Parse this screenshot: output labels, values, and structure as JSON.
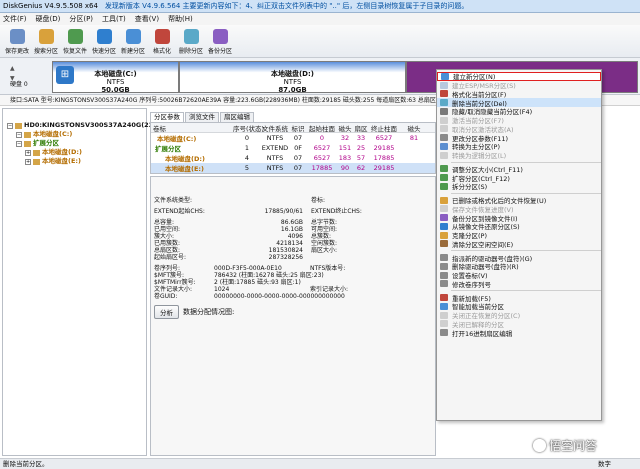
{
  "window": {
    "title": "DiskGenius V4.9.5.508 x64",
    "notice": "发现新版本 V4.9.6.564 主要更新内容如下：4、纠正双击文件列表中的 \"..\" 后，左侧目录树恢复属于子目录的问题。"
  },
  "menu": [
    "文件(F)",
    "硬盘(D)",
    "分区(P)",
    "工具(T)",
    "查看(V)",
    "帮助(H)"
  ],
  "toolbar": [
    {
      "label": "保存更改",
      "icon": "save-icon",
      "color": "#6b8fc6"
    },
    {
      "label": "搜索分区",
      "icon": "search-icon",
      "color": "#d9a13b"
    },
    {
      "label": "恢复文件",
      "icon": "recover-icon",
      "color": "#4f9a4f"
    },
    {
      "label": "快速分区",
      "icon": "quick-partition-icon",
      "color": "#2f7fcf"
    },
    {
      "label": "新建分区",
      "icon": "new-partition-icon",
      "color": "#4a8fd6"
    },
    {
      "label": "格式化",
      "icon": "format-icon",
      "color": "#c0463c"
    },
    {
      "label": "删除分区",
      "icon": "delete-partition-icon",
      "color": "#5aa9c8"
    },
    {
      "label": "备份分区",
      "icon": "backup-icon",
      "color": "#8a5ec2"
    }
  ],
  "disk_strip": {
    "disk_label": "硬盘 0",
    "partitions": [
      {
        "name": "本地磁盘(C:)",
        "fs": "NTFS",
        "size": "50.0GB"
      },
      {
        "name": "本地磁盘(D:)",
        "fs": "NTFS",
        "size": "87.0GB"
      },
      {
        "name": "",
        "fs": "",
        "size": ""
      }
    ]
  },
  "disk_info": "接口:SATA  型号:KINGSTONSV300S37A240G  序列号:50026B72620AE39A  容量:223.6GB(228936MB)  柱面数:29185  磁头数:255  每道扇区数:63  总扇区数:468862128",
  "tree": [
    {
      "text": "HD0:KINGSTONSV300S37A240G(224GB)",
      "level": 0,
      "style": "bold"
    },
    {
      "text": "本地磁盘(C:)",
      "level": 1,
      "style": "orange"
    },
    {
      "text": "扩展分区",
      "level": 1,
      "style": "green"
    },
    {
      "text": "本地磁盘(D:)",
      "level": 2,
      "style": "orange"
    },
    {
      "text": "本地磁盘(E:)",
      "level": 2,
      "style": "orange"
    }
  ],
  "tabs": [
    "分区参数",
    "浏览文件",
    "扇区编辑"
  ],
  "ptable": {
    "headers": [
      "卷标",
      "序号(状态)",
      "文件系统",
      "标识",
      "起始柱面",
      "磁头",
      "扇区",
      "终止柱面",
      "磁头"
    ],
    "rows": [
      {
        "label": "本地磁盘(C:)",
        "cells": [
          "0",
          "NTFS",
          "07",
          "0",
          "32",
          "33",
          "6527",
          "81"
        ],
        "cls": ""
      },
      {
        "label": "扩展分区",
        "cells": [
          "1",
          "EXTEND",
          "0F",
          "6527",
          "151",
          "25",
          "29185",
          ""
        ],
        "cls": ""
      },
      {
        "label": "本地磁盘(D:)",
        "cells": [
          "4",
          "NTFS",
          "07",
          "6527",
          "183",
          "57",
          "17885",
          ""
        ],
        "cls": ""
      },
      {
        "label": "本地磁盘(E:)",
        "cells": [
          "5",
          "NTFS",
          "07",
          "17885",
          "90",
          "62",
          "29185",
          ""
        ],
        "cls": "sel"
      }
    ]
  },
  "details": {
    "fs_type_label": "文件系统类型:",
    "fs_type_value": "",
    "vol_label_label": "卷标:",
    "vol_label_value": "",
    "extend_chs_label": "EXTEND起始CHS:",
    "extend_chs_value": "17885/90/61",
    "extend_end_label": "EXTEND终止CHS:",
    "rows1": [
      {
        "k": "总容量:",
        "v": "86.6GB",
        "k2": "总字节数:",
        "v2": ""
      },
      {
        "k": "已用空间:",
        "v": "16.1GB",
        "k2": "可用空间:",
        "v2": ""
      },
      {
        "k": "簇大小:",
        "v": "4096",
        "k2": "总簇数:",
        "v2": ""
      },
      {
        "k": "已用簇数:",
        "v": "4218134",
        "k2": "空闲簇数:",
        "v2": ""
      },
      {
        "k": "总扇区数:",
        "v": "181530824",
        "k2": "扇区大小:",
        "v2": ""
      },
      {
        "k": "起始扇区号:",
        "v": "287328256",
        "k2": "",
        "v2": ""
      }
    ],
    "rows2": [
      {
        "k": "卷序列号:",
        "v": "000D-F3F5-000A-0E10",
        "k2": "NTFS版本号:",
        "v2": ""
      },
      {
        "k": "$MFT簇号:",
        "v": "786432 (柱面:16278 磁头:25 扇区:23)",
        "k2": "",
        "v2": ""
      },
      {
        "k": "$MFTMirr簇号:",
        "v": "2 (柱面:17885 磁头:93 扇区:1)",
        "k2": "",
        "v2": ""
      },
      {
        "k": "文件记录大小:",
        "v": "1024",
        "k2": "索引记录大小:",
        "v2": ""
      },
      {
        "k": "卷GUID:",
        "v": "00000000-0000-0000-0000-000000000000",
        "k2": "",
        "v2": ""
      }
    ],
    "analyze_button": "分析",
    "analyze_label": "数据分配情况图:"
  },
  "context_menu": [
    {
      "label": "建立新分区(N)",
      "state": "highlight",
      "color": "#4a8fd6"
    },
    {
      "label": "建立ESP/MSR分区(S)",
      "state": "disabled",
      "color": "#b7c8de"
    },
    {
      "label": "格式化当前分区(F)",
      "state": "normal",
      "color": "#c0463c"
    },
    {
      "label": "删除当前分区(Del)",
      "state": "hover",
      "color": "#5aa9c8"
    },
    {
      "label": "隐藏/取消隐藏当前分区(F4)",
      "state": "normal",
      "color": "#7a7a7a"
    },
    {
      "label": "激活当前分区(F7)",
      "state": "disabled",
      "color": "#cfcfcf"
    },
    {
      "label": "取消分区激活状态(A)",
      "state": "disabled",
      "color": "#cfcfcf"
    },
    {
      "label": "更改分区参数(F11)",
      "state": "normal",
      "color": "#8a8a8a"
    },
    {
      "label": "转换为主分区(P)",
      "state": "normal",
      "color": "#5d8fd0"
    },
    {
      "label": "转换为逻辑分区(L)",
      "state": "disabled",
      "color": "#cfcfcf"
    },
    {
      "sep": true
    },
    {
      "label": "调整分区大小(Ctrl_F11)",
      "state": "normal",
      "color": "#4f9a4f"
    },
    {
      "label": "扩容分区(Ctrl_F12)",
      "state": "normal",
      "color": "#4f9a4f"
    },
    {
      "label": "拆分分区(S)",
      "state": "normal",
      "color": "#4f9a4f"
    },
    {
      "sep": true
    },
    {
      "label": "已删除或格式化后的文件恢复(U)",
      "state": "normal",
      "color": "#d9a13b"
    },
    {
      "label": "保存文件恢复进度(V)",
      "state": "disabled",
      "color": "#cfcfcf"
    },
    {
      "label": "备份分区到镜像文件(I)",
      "state": "normal",
      "color": "#8a5ec2"
    },
    {
      "label": "从镜像文件还原分区(S)",
      "state": "normal",
      "color": "#2f7fcf"
    },
    {
      "label": "克隆分区(P)",
      "state": "normal",
      "color": "#d9a13b"
    },
    {
      "label": "清除分区空闲空间(E)",
      "state": "normal",
      "color": "#9a6b3b"
    },
    {
      "sep": true
    },
    {
      "label": "指派新的驱动器号(盘符)(G)",
      "state": "normal",
      "color": "#8a8a8a"
    },
    {
      "label": "删除驱动器号(盘符)(R)",
      "state": "normal",
      "color": "#8a8a8a"
    },
    {
      "label": "设置卷标(V)",
      "state": "normal",
      "color": "#8a8a8a"
    },
    {
      "label": "修改卷序列号",
      "state": "normal",
      "color": "#8a8a8a"
    },
    {
      "sep": true
    },
    {
      "label": "重新加载(F5)",
      "state": "normal",
      "color": "#c0463c"
    },
    {
      "label": "智能加载当前分区",
      "state": "normal",
      "color": "#4a8fd6"
    },
    {
      "label": "关闭正在恢复的分区(C)",
      "state": "disabled",
      "color": "#cfcfcf"
    },
    {
      "label": "关闭已解释的分区",
      "state": "disabled",
      "color": "#cfcfcf"
    },
    {
      "label": "打开16进制扇区编辑",
      "state": "normal",
      "color": "#8a8a8a"
    }
  ],
  "status": {
    "text": "删除当前分区。",
    "numlock": "数字"
  },
  "watermark": "悟空问答"
}
